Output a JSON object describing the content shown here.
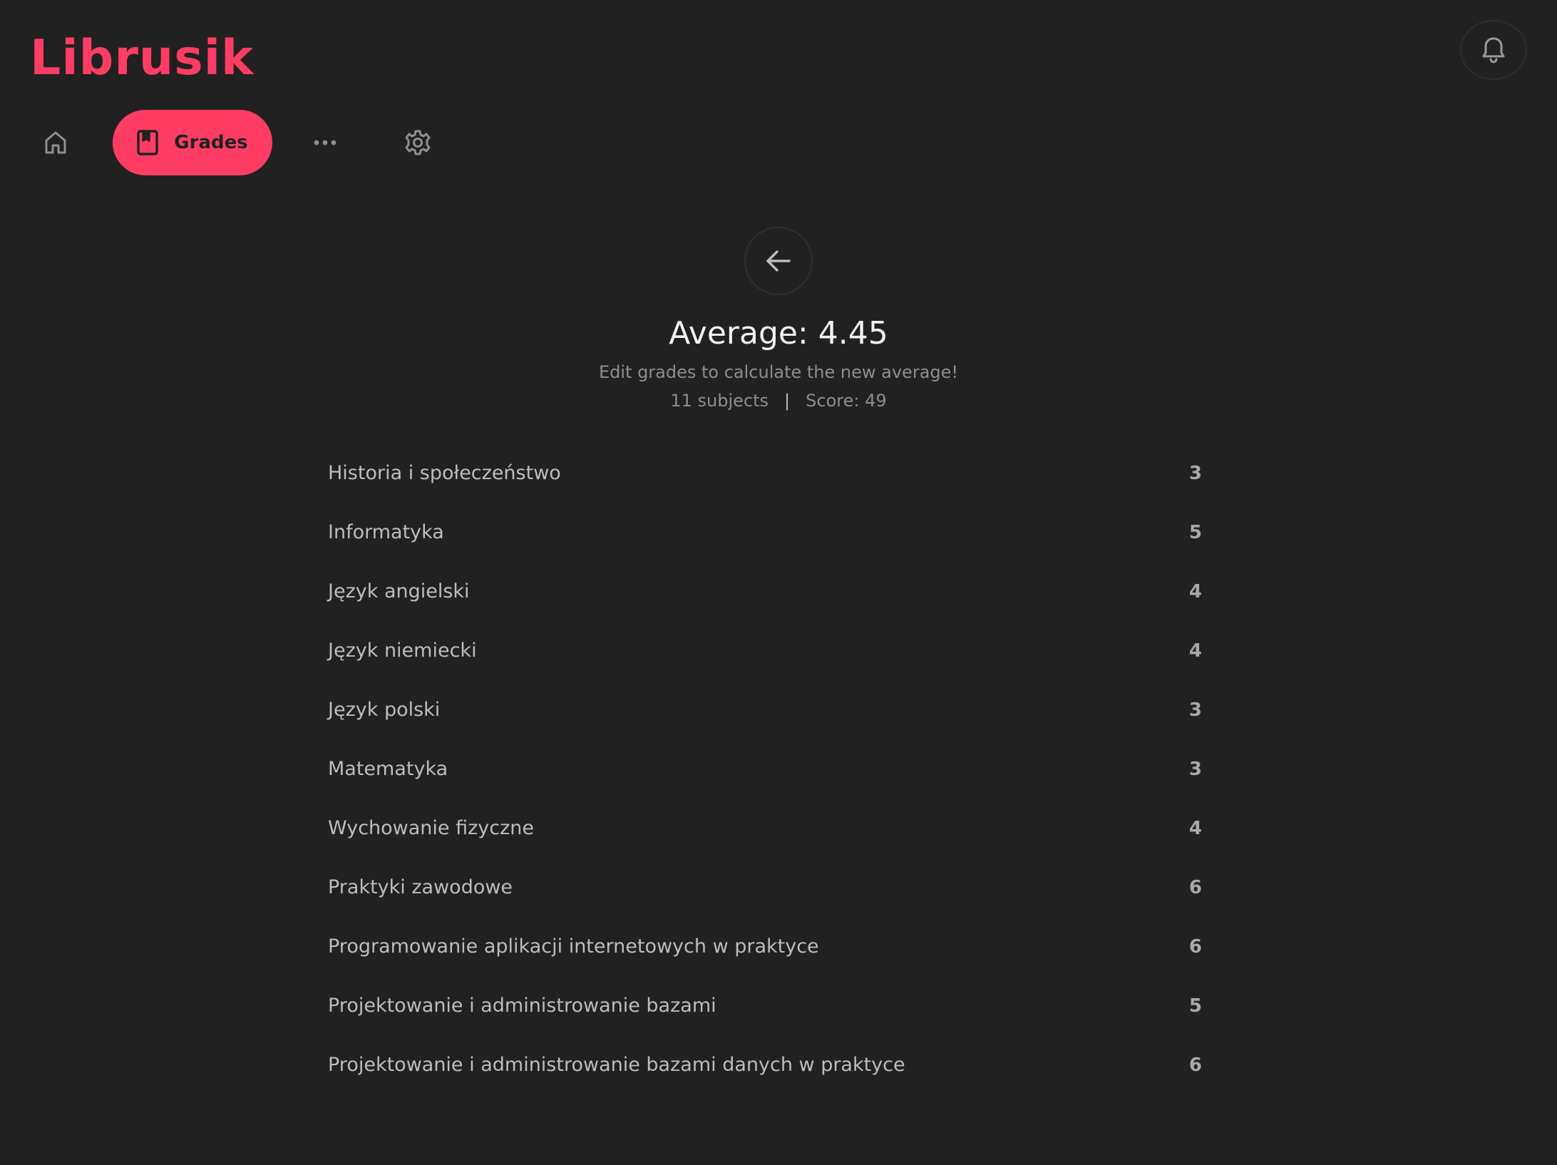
{
  "app": {
    "logo": "Librusik",
    "accent_color": "#ff3d64",
    "background_color": "#212121"
  },
  "header": {
    "notifications_icon": "bell-icon"
  },
  "nav": {
    "home_icon": "home-icon",
    "grades_icon": "bookmark-icon",
    "grades_label": "Grades",
    "more_icon": "more-horizontal-icon",
    "settings_icon": "gear-icon"
  },
  "main": {
    "back_icon": "arrow-left-icon",
    "average_text": "Average: 4.45",
    "hint": "Edit grades to calculate the new average!",
    "subjects_count": "11 subjects",
    "separator": "|",
    "score": "Score: 49",
    "grades": [
      {
        "subject": "Historia i społeczeństwo",
        "grade": "3"
      },
      {
        "subject": "Informatyka",
        "grade": "5"
      },
      {
        "subject": "Język angielski",
        "grade": "4"
      },
      {
        "subject": "Język niemiecki",
        "grade": "4"
      },
      {
        "subject": "Język polski",
        "grade": "3"
      },
      {
        "subject": "Matematyka",
        "grade": "3"
      },
      {
        "subject": "Wychowanie fizyczne",
        "grade": "4"
      },
      {
        "subject": "Praktyki zawodowe",
        "grade": "6"
      },
      {
        "subject": "Programowanie aplikacji internetowych w praktyce",
        "grade": "6"
      },
      {
        "subject": "Projektowanie i administrowanie bazami",
        "grade": "5"
      },
      {
        "subject": "Projektowanie i administrowanie bazami danych w praktyce",
        "grade": "6"
      }
    ]
  }
}
